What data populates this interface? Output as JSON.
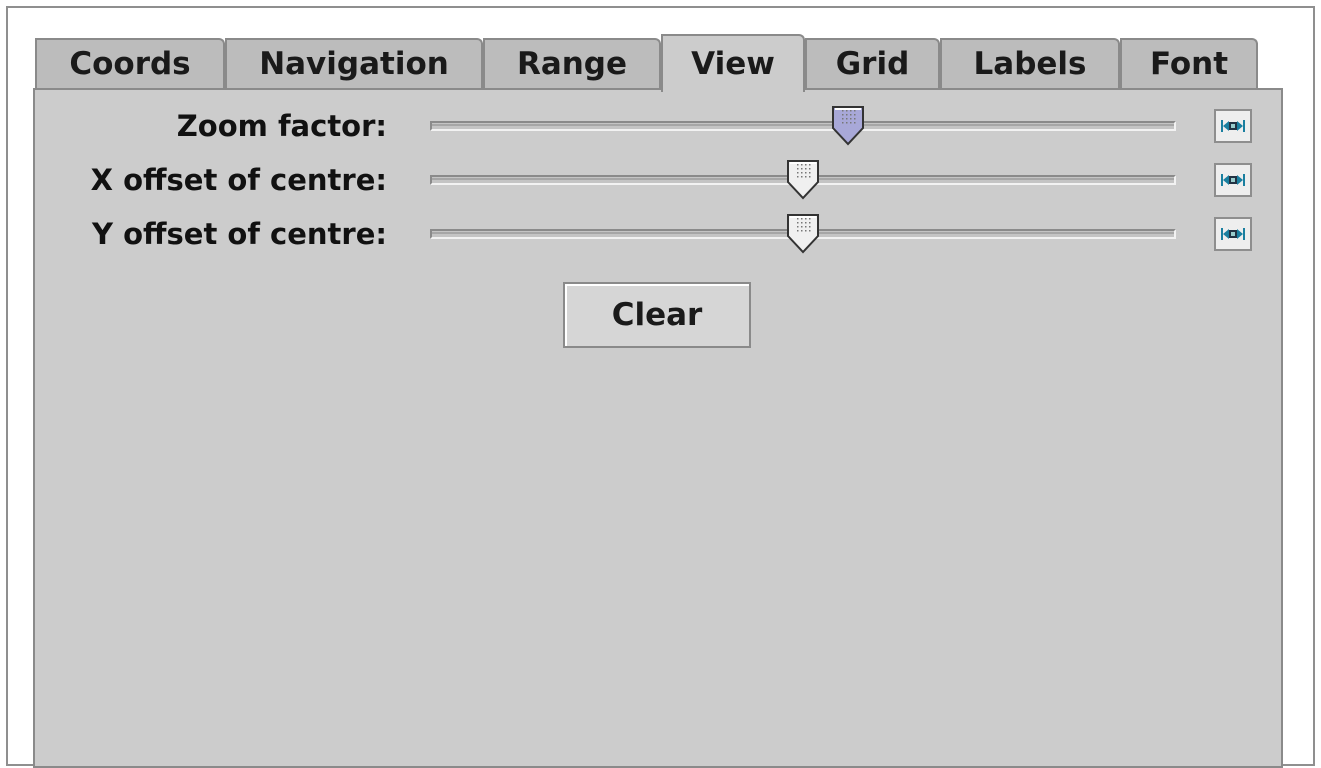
{
  "tabs": [
    {
      "label": "Coords",
      "active": false
    },
    {
      "label": "Navigation",
      "active": false
    },
    {
      "label": "Range",
      "active": false
    },
    {
      "label": "View",
      "active": true
    },
    {
      "label": "Grid",
      "active": false
    },
    {
      "label": "Labels",
      "active": false
    },
    {
      "label": "Font",
      "active": false
    }
  ],
  "view": {
    "rows": [
      {
        "label": "Zoom factor:",
        "value": 0.56,
        "selected": true
      },
      {
        "label": "X offset of centre:",
        "value": 0.5,
        "selected": false
      },
      {
        "label": "Y offset of centre:",
        "value": 0.5,
        "selected": false
      }
    ],
    "reset_icon": "reset-center-icon",
    "clear_label": "Clear"
  },
  "colors": {
    "panel_bg": "#cccccc",
    "tab_bg": "#bcbcbc",
    "thumb_selected": "#a8a8d8",
    "thumb_normal": "#f0f0f0",
    "icon_teal": "#1a7fa0"
  }
}
